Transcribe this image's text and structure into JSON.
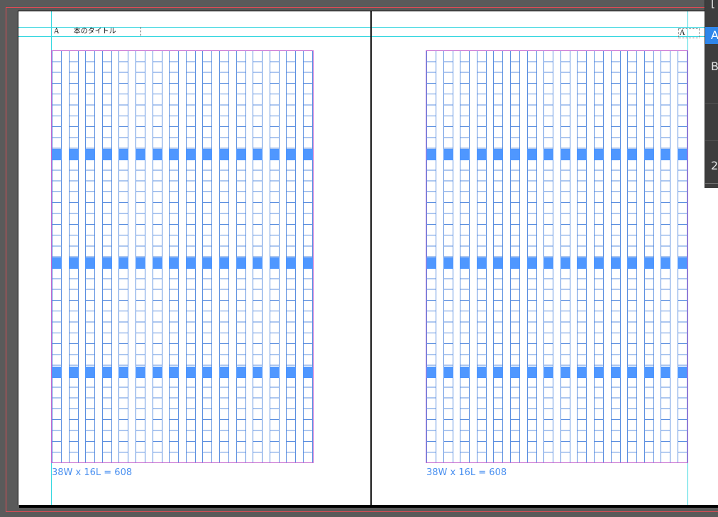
{
  "document": {
    "running_head_marker": "A",
    "running_head_title": "本のタイトル",
    "right_page_marker": "A"
  },
  "left_page": {
    "grid": {
      "columns": 16,
      "caption": "38W x 16L = 608"
    }
  },
  "right_page": {
    "grid": {
      "columns": 16,
      "caption": "38W x 16L = 608"
    }
  },
  "pages_panel": {
    "items": [
      {
        "label": "[",
        "selected": false
      },
      {
        "label": "A",
        "selected": true
      },
      {
        "label": "B",
        "selected": false
      },
      {
        "label": "2",
        "selected": false
      }
    ]
  },
  "colors": {
    "pasteboard": "#5a5a5a",
    "page": "#ffffff",
    "guide": "#36d7e0",
    "bleed": "#e04b55",
    "margin": "#c66ad0",
    "grid_line": "#5b8fe0",
    "grid_band": "#4f97ff",
    "panel": "#3d3d3d",
    "panel_selected": "#2f86ea"
  }
}
